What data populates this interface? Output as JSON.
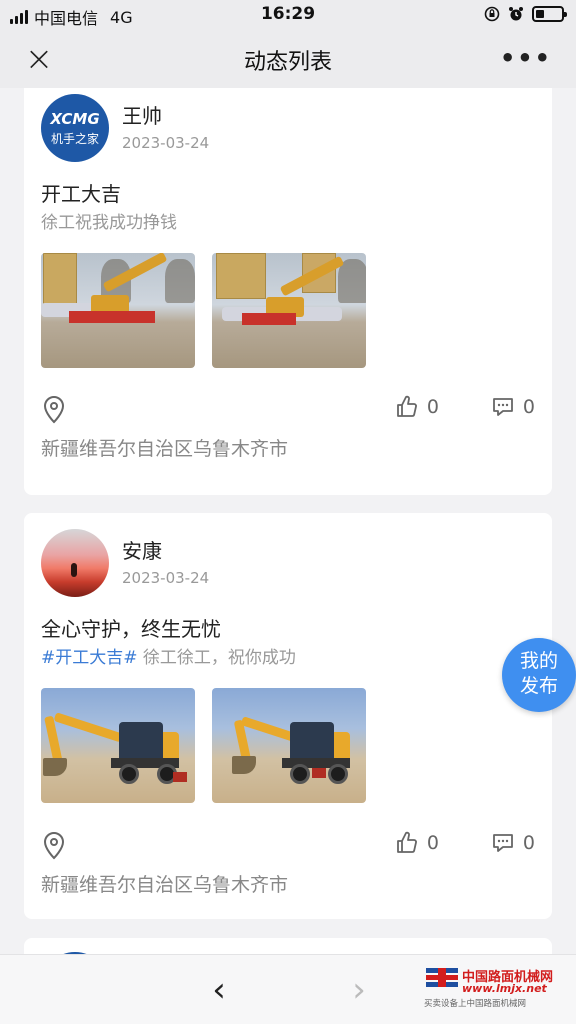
{
  "status_bar": {
    "carrier": "中国电信",
    "network": "4G",
    "time": "16:29",
    "battery_level": 0.35
  },
  "nav": {
    "close_icon": "close-icon",
    "title": "动态列表",
    "more_icon": "more-icon"
  },
  "posts": [
    {
      "avatar": "xcmg-logo-avatar",
      "avatar_text": "XCMG",
      "avatar_subtext": "机手之家",
      "author": "王帅",
      "date": "2023-03-24",
      "title": "开工大吉",
      "tag": "",
      "body": "徐工祝我成功挣钱",
      "likes": "0",
      "comments": "0",
      "location": "新疆维吾尔自治区乌鲁木齐市"
    },
    {
      "avatar": "sunset-avatar",
      "author": "安康",
      "date": "2023-03-24",
      "title": "全心守护，终生无忧",
      "tag": "#开工大吉#",
      "body": " 徐工徐工，祝你成功",
      "likes": "0",
      "comments": "0",
      "location": "新疆维吾尔自治区乌鲁木齐市"
    }
  ],
  "fab": {
    "line1": "我的",
    "line2": "发布"
  },
  "bottom_bar": {
    "back_icon": "chevron-left-icon",
    "forward_icon": "chevron-right-icon"
  },
  "watermark": {
    "name": "中国路面机械网",
    "url": "www.lmjx.net",
    "sub": "买卖设备上中国路面机械网"
  },
  "colors": {
    "accent": "#3f8ff0",
    "tag": "#3a7bd5",
    "xcmg_blue": "#1e58a6",
    "watermark_red": "#d21d1d"
  }
}
